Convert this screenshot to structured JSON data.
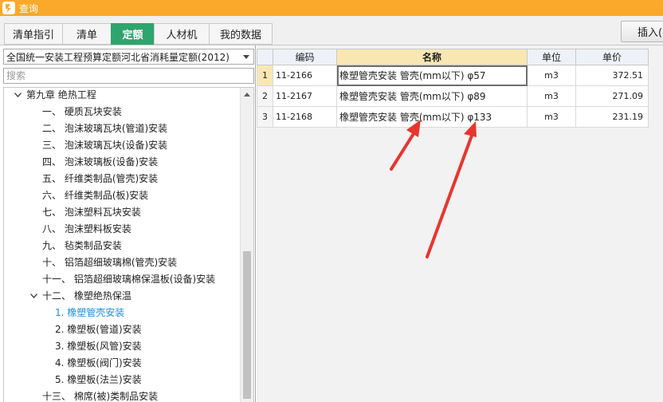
{
  "window": {
    "title": "查询"
  },
  "tabs": [
    {
      "label": "清单指引"
    },
    {
      "label": "清单"
    },
    {
      "label": "定额",
      "active": true
    },
    {
      "label": "人材机"
    },
    {
      "label": "我的数据"
    }
  ],
  "toolbar": {
    "insert_label": "插入(I)"
  },
  "left": {
    "quota_library": "全国统一安装工程预算定额河北省消耗量定额(2012)",
    "search_placeholder": "搜索",
    "tree": [
      {
        "label": "第九章 绝热工程",
        "level": 0,
        "expanded": true
      },
      {
        "label": "一、 硬质瓦块安装",
        "level": 2
      },
      {
        "label": "二、 泡沫玻璃瓦块(管道)安装",
        "level": 2
      },
      {
        "label": "三、 泡沫玻璃瓦块(设备)安装",
        "level": 2
      },
      {
        "label": "四、 泡沫玻璃板(设备)安装",
        "level": 2
      },
      {
        "label": "五、 纤维类制品(管壳)安装",
        "level": 2
      },
      {
        "label": "六、 纤维类制品(板)安装",
        "level": 2
      },
      {
        "label": "七、 泡沫塑料瓦块安装",
        "level": 2
      },
      {
        "label": "八、 泡沫塑料板安装",
        "level": 2
      },
      {
        "label": "九、 毡类制品安装",
        "level": 2
      },
      {
        "label": "十、 铝箔超细玻璃棉(管壳)安装",
        "level": 2
      },
      {
        "label": "十一、 铝箔超细玻璃棉保温板(设备)安装",
        "level": 2
      },
      {
        "label": "十二、 橡塑绝热保温",
        "level": 1,
        "expanded": true
      },
      {
        "label": "1. 橡塑管壳安装",
        "level": 3,
        "selected": true
      },
      {
        "label": "2. 橡塑板(管道)安装",
        "level": 3
      },
      {
        "label": "3. 橡塑板(风管)安装",
        "level": 3
      },
      {
        "label": "4. 橡塑板(阀门)安装",
        "level": 3
      },
      {
        "label": "5. 橡塑板(法兰)安装",
        "level": 3
      },
      {
        "label": "十三、 棉席(被)类制品安装",
        "level": 2
      }
    ]
  },
  "grid": {
    "columns": [
      "",
      "编码",
      "名称",
      "单位",
      "单价"
    ],
    "rows": [
      {
        "index": "1",
        "code": "11-2166",
        "name": "橡塑管壳安装 管壳(mm以下) φ57",
        "unit": "m3",
        "price": "372.51"
      },
      {
        "index": "2",
        "code": "11-2167",
        "name": "橡塑管壳安装 管壳(mm以下) φ89",
        "unit": "m3",
        "price": "271.09"
      },
      {
        "index": "3",
        "code": "11-2168",
        "name": "橡塑管壳安装 管壳(mm以下) φ133",
        "unit": "m3",
        "price": "231.19"
      }
    ]
  },
  "colors": {
    "titlebar": "#fba92a",
    "active_tab": "#2ea56e",
    "annotation": "#e8352f",
    "selected_tree": "#1a8ee0"
  }
}
